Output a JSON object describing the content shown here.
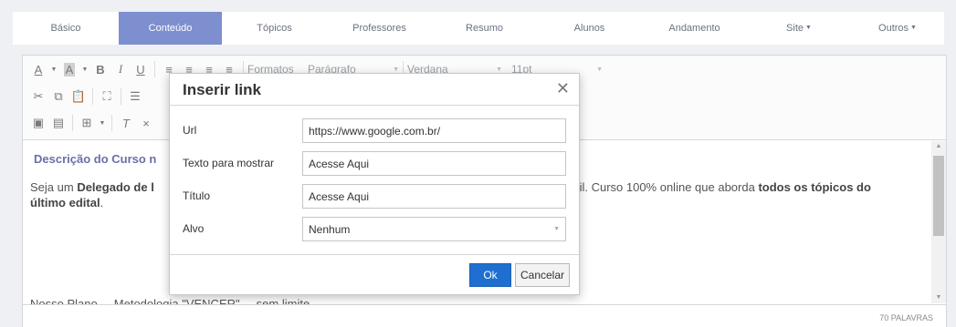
{
  "tabs": {
    "items": [
      {
        "label": "Básico"
      },
      {
        "label": "Conteúdo"
      },
      {
        "label": "Tópicos"
      },
      {
        "label": "Professores"
      },
      {
        "label": "Resumo"
      },
      {
        "label": "Alunos"
      },
      {
        "label": "Andamento"
      },
      {
        "label": "Site"
      },
      {
        "label": "Outros"
      }
    ],
    "active": "Conteúdo"
  },
  "toolbar": {
    "formats": "Formatos",
    "block": "Parágrafo",
    "font": "Verdana",
    "size": "11pt"
  },
  "content": {
    "title": "Descrição do Curso n",
    "p1_a": "Seja um ",
    "p1_b": "Delegado de l",
    "p1_c": "asil. Curso 100% online que aborda ",
    "p1_d": "todos os tópicos do",
    "p1_e": "último edital",
    "p1_f": ".",
    "p2": "Nosso Plano ... Metodologia \"VENCER\" ... sem limite"
  },
  "status": {
    "word_count": "70 PALAVRAS"
  },
  "dialog": {
    "title": "Inserir link",
    "url_label": "Url",
    "url_value": "https://www.google.com.br/",
    "text_label": "Texto para mostrar",
    "text_value": "Acesse Aqui",
    "title_label": "Título",
    "title_value": "Acesse Aqui",
    "target_label": "Alvo",
    "target_value": "Nenhum",
    "ok": "Ok",
    "cancel": "Cancelar"
  }
}
